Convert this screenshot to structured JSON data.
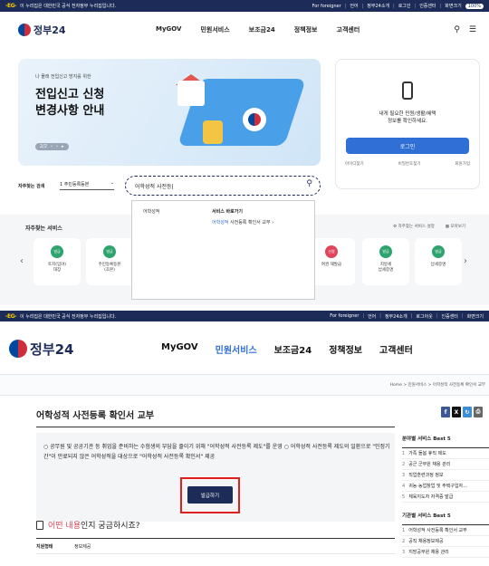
{
  "topbar": {
    "notice": "이 누리집은 대한민국 공식 전자정부 누리집입니다.",
    "links": [
      "For foreigner",
      "언어",
      "정부24소개",
      "로그인",
      "인증센터",
      "화면크기",
      "100%"
    ]
  },
  "topbar2": {
    "links": [
      "For foreigner",
      "언어",
      "정부24소개",
      "로그아웃",
      "인증센터",
      "화면크기"
    ]
  },
  "logo": "정부24",
  "nav": [
    "MyGOV",
    "민원서비스",
    "보조금24",
    "정책정보",
    "고객센터"
  ],
  "hero": {
    "small": "나 몰래 전입신고 방지를 위한",
    "title_line1": "전입신고 신청",
    "title_line2": "변경사항 안내",
    "pager": "2/2"
  },
  "login": {
    "msg1": "내게 필요한 민원/생활/혜택",
    "msg2": "정보를 확인하세요.",
    "button": "로그인",
    "find_id": "아이디찾기",
    "find_pw": "비밀번호찾기",
    "join": "회원가입"
  },
  "search": {
    "label": "자주찾는 검색",
    "select": "1 주민등록등본",
    "value": "어학성적 사전등|"
  },
  "dropdown": {
    "col1": "어학성적",
    "col2": "서비스 바로가기",
    "result_hl": "어학성적",
    "result_rest": " 사전등록 확인서 교부"
  },
  "services": {
    "title": "자주찾는 서비스",
    "setting": "자주찾는 서비스 설정",
    "all": "모아보기",
    "cards": [
      {
        "badge": "발급",
        "line1": "토지(임야)",
        "line2": "대장"
      },
      {
        "badge": "발급",
        "line1": "주민등록등본",
        "line2": "(초본)"
      },
      {
        "badge": "신청",
        "line1": "여권 재발급",
        "line2": ""
      },
      {
        "badge": "발급",
        "line1": "지방세",
        "line2": "납세증명"
      },
      {
        "badge": "발급",
        "line1": "납세증명",
        "line2": ""
      }
    ]
  },
  "breadcrumb": "Home > 민원서비스 > 어학성적 사전등록 확인서 교부",
  "page": {
    "title": "어학성적 사전등록 확인서 교부",
    "info": "○ 공무원 및 공공기관 등 취업을 준비하는 수험생의 부담을 줄이기 위해 \"어학성적 사전등록 제도\"를 운영 ○ 어학성적 사전등록 제도의 일환으로 \"인정기간\"이 만료되지 않은 어학성적을 대상으로 \"어학성적 사전등록 확인서\" 제공",
    "apply": "발급하기"
  },
  "question": {
    "hl": "어떤 내용",
    "rest": "인지 궁금하시죠?",
    "row_key": "지원형태",
    "row_val": "정보제공"
  },
  "sidebar": {
    "best1_title": "분야별 서비스 Best 5",
    "best1": [
      "가족 돌봄 휴직 제도",
      "공군 군무원 채용 관리",
      "직업훈련과정 정보",
      "귀농·농업창업 및 주택구입자...",
      "체육지도자 자격증 발급"
    ],
    "best2_title": "기관별 서비스 Best 5",
    "best2": [
      "어학성적 사전등록 확인서 교부",
      "공직 채용정보제공",
      "지방공무원 채용 관리"
    ]
  },
  "colors": {
    "navy": "#1c2b57",
    "blue": "#2f6fd6",
    "red": "#e02020"
  }
}
